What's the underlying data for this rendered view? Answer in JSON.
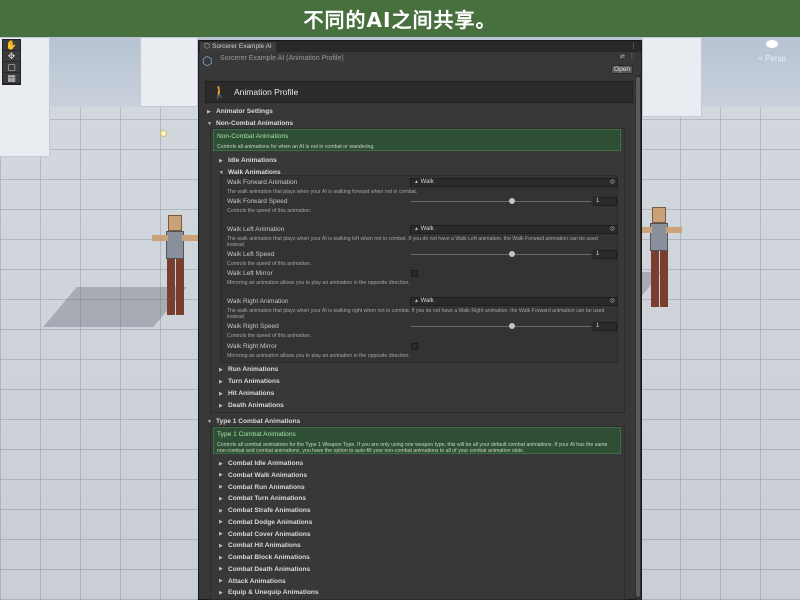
{
  "banner": {
    "text": "不同的AI之间共享。"
  },
  "scene": {
    "view_label": "< Persp",
    "tools": [
      "hand-tool-icon",
      "move-tool-icon",
      "rect-tool-icon",
      "grid-tool-icon"
    ]
  },
  "window": {
    "tab_label": "Sorcerer Example AI",
    "asset_title": "Sorcerer Example AI (Animation Profile)",
    "open_label": "Open",
    "profile_title": "Animation Profile"
  },
  "sections": {
    "animator_settings": "Animator Settings",
    "non_combat": {
      "label": "Non-Combat Animations",
      "box_title": "Non-Combat Animations",
      "box_desc": "Controls all animations for when an AI is not in combat or wandering.",
      "idle": "Idle Animations",
      "walk": "Walk Animations",
      "run": "Run Animations",
      "turn": "Turn Animations",
      "hit": "Hit Animations",
      "death": "Death Animations"
    },
    "walk": {
      "forward_label": "Walk Forward Animation",
      "forward_value": "Walk",
      "forward_desc": "The walk animation that plays when your AI is walking forward when not in combat.",
      "forward_speed_label": "Walk Forward Speed",
      "forward_speed_value": "1",
      "forward_speed_desc": "Controls the speed of this animation.",
      "left_label": "Walk Left Animation",
      "left_value": "Walk",
      "left_desc": "The walk animation that plays when your AI is walking left when not in combat. If you do not have a Walk Left animation, the Walk Forward animation can be used instead.",
      "left_speed_label": "Walk Left Speed",
      "left_speed_value": "1",
      "left_speed_desc": "Controls the speed of this animation.",
      "left_mirror_label": "Walk Left Mirror",
      "left_mirror_desc": "Mirroring an animation allows you to play an animation in the opposite direction.",
      "right_label": "Walk Right Animation",
      "right_value": "Walk",
      "right_desc": "The walk animation that plays when your AI is walking right when not in combat. If you do not have a Walk Right animation, the Walk Forward animation can be used instead.",
      "right_speed_label": "Walk Right Speed",
      "right_speed_value": "1",
      "right_speed_desc": "Controls the speed of this animation.",
      "right_mirror_label": "Walk Right Mirror",
      "right_mirror_desc": "Mirroring an animation allows you to play an animation in the opposite direction."
    },
    "type1": {
      "label": "Type 1 Combat Animations",
      "box_title": "Type 1 Combat Animations",
      "box_desc": "Controls all combat animations for the Type 1 Weapon Type. If you are only using one weapon type, this will be all your default combat animations. If your AI has the same non-combat and combat animations, you have the option to auto-fill your non-combat animations to all of your combat animation slots.",
      "items": [
        "Combat Idle Animations",
        "Combat Walk Animations",
        "Combat Run Animations",
        "Combat Turn Animations",
        "Combat Strafe Animations",
        "Combat Dodge Animations",
        "Combat Cover Animations",
        "Combat Hit Animations",
        "Combat Block Animations",
        "Combat Death Animations",
        "Attack Animations",
        "Equip & Unequip Animations"
      ]
    }
  },
  "colors": {
    "banner": "#48703f",
    "panel": "#383838",
    "green_box": "#2e4f35",
    "green_title": "#a8e0a6"
  }
}
